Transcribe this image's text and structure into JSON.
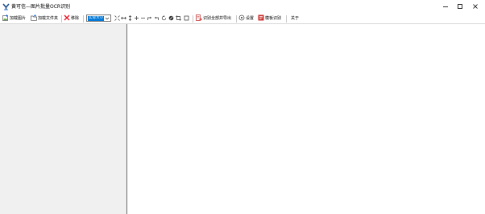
{
  "window": {
    "title": "黄可信—图片批量OCR识别",
    "controls": [
      "minimize-icon",
      "maximize-icon",
      "close-icon"
    ]
  },
  "toolbar": {
    "add_image_label": "加载图片",
    "add_folder_label": "加载文件夹",
    "remove_label": "移除",
    "zoom_value": "实际大小",
    "view_icons": [
      "fit-window-icon",
      "fit-width-icon",
      "fit-height-icon",
      "zoom-in-icon",
      "zoom-out-icon",
      "redo-icon",
      "undo-icon",
      "rotate-right-icon",
      "flip-icon",
      "crop-icon",
      "rectangle-icon"
    ],
    "export_all_label": "识别全部并导出",
    "settings_label": "设置",
    "template_label": "模板识别",
    "about_label": "关于"
  },
  "colors": {
    "accent": "#0078d7",
    "remove_red": "#e81123",
    "panel_bg": "#f0f0f0"
  }
}
